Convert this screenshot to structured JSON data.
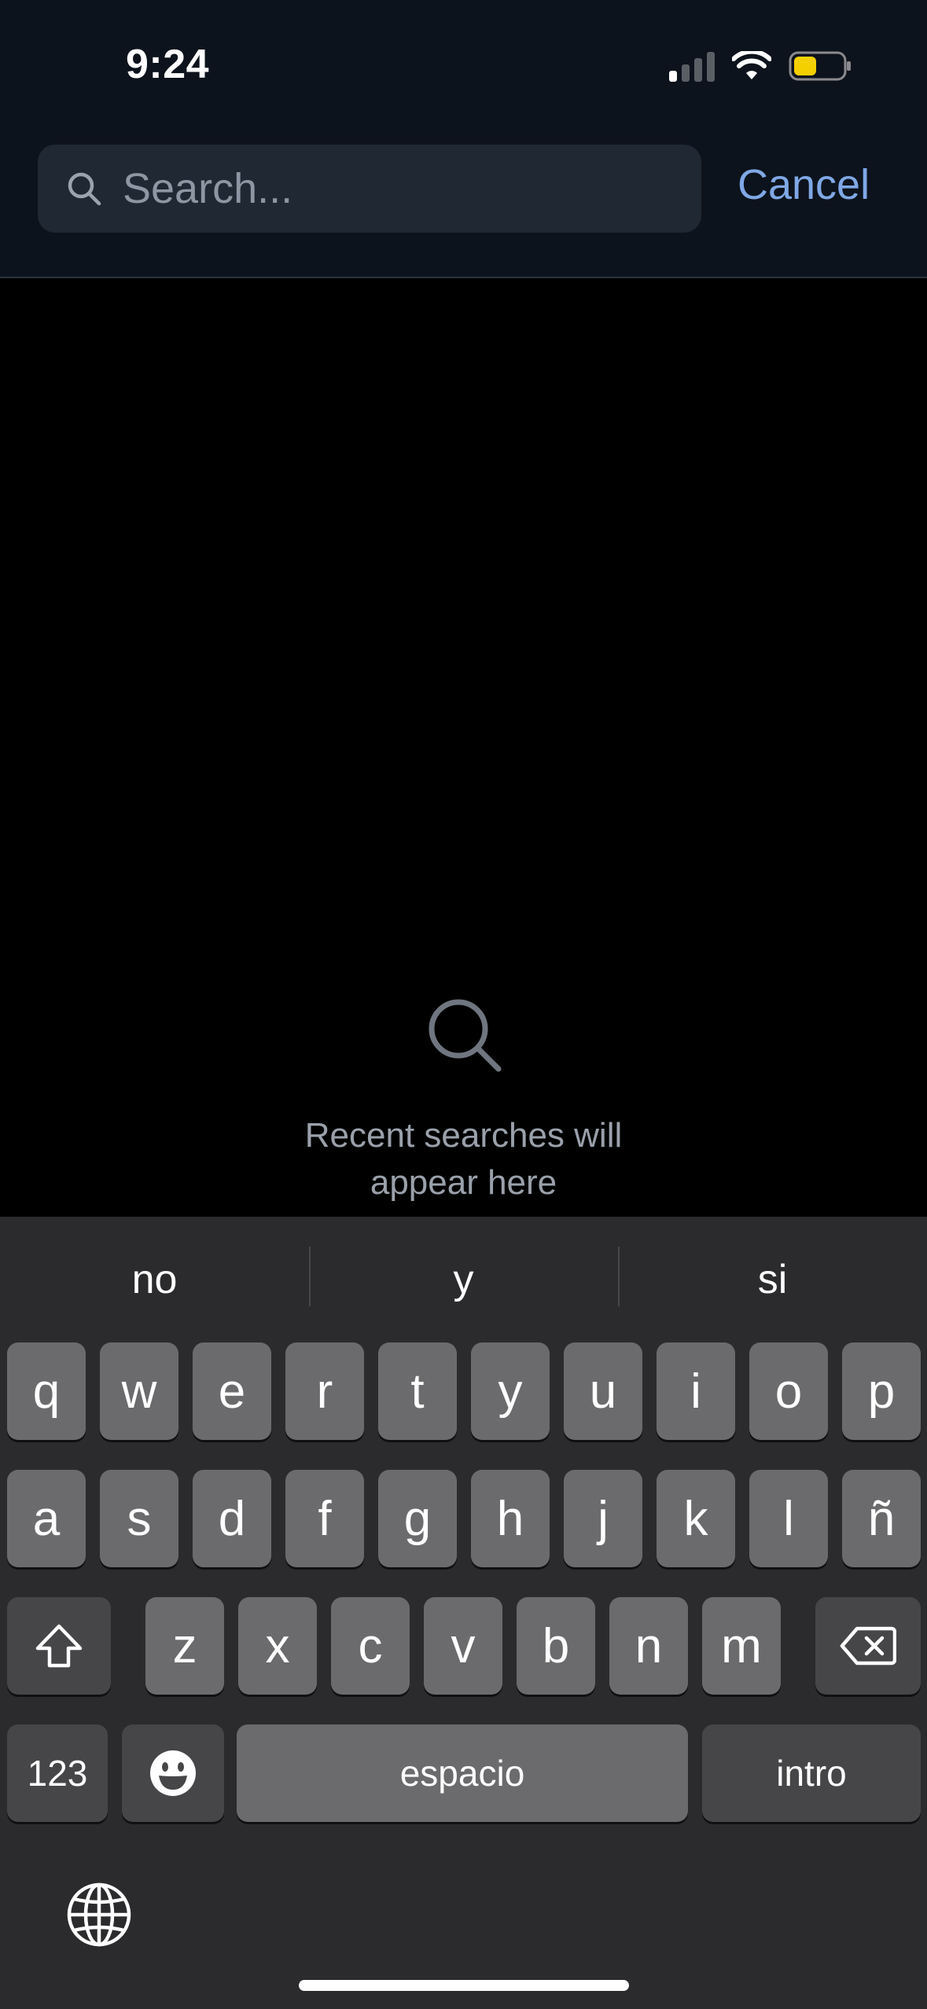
{
  "status_bar": {
    "time": "9:24",
    "icons": [
      "cellular-signal-icon",
      "wifi-icon",
      "battery-icon"
    ],
    "battery_color": "#f5d000"
  },
  "search": {
    "placeholder": "Search...",
    "value": "",
    "cancel_label": "Cancel"
  },
  "empty_state": {
    "icon": "search-icon",
    "message": "Recent searches will appear here"
  },
  "keyboard": {
    "suggestions": [
      "no",
      "y",
      "si"
    ],
    "row1": [
      "q",
      "w",
      "e",
      "r",
      "t",
      "y",
      "u",
      "i",
      "o",
      "p"
    ],
    "row2": [
      "a",
      "s",
      "d",
      "f",
      "g",
      "h",
      "j",
      "k",
      "l",
      "ñ"
    ],
    "row3": [
      "z",
      "x",
      "c",
      "v",
      "b",
      "n",
      "m"
    ],
    "numbers_label": "123",
    "space_label": "espacio",
    "return_label": "intro",
    "special_icons": [
      "shift-icon",
      "backspace-icon",
      "emoji-icon",
      "globe-icon"
    ]
  },
  "colors": {
    "accent": "#7fa8e6",
    "header_bg": "#0d131c",
    "search_field_bg": "#1f2833",
    "keyboard_bg": "#2b2b2d"
  }
}
